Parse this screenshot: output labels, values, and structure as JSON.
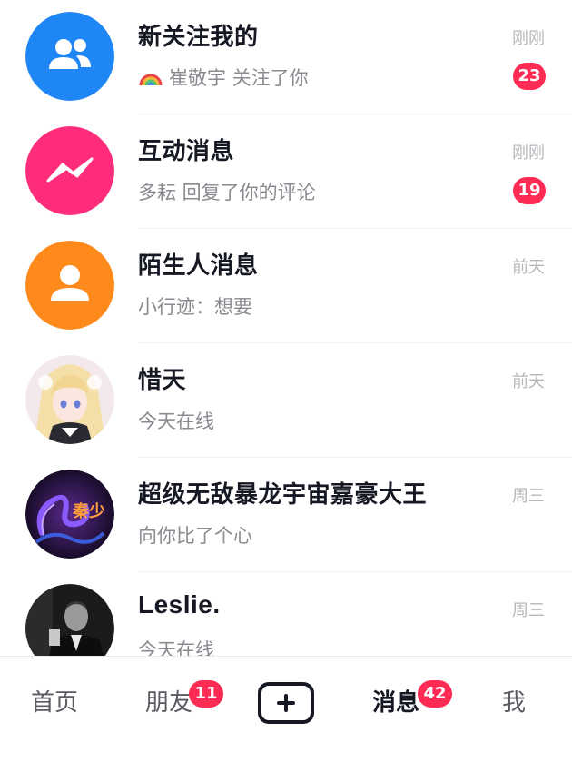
{
  "conversations": [
    {
      "title": "新关注我的",
      "subtitle": "崔敬宇 关注了你",
      "subtitle_icon": "rainbow-emoji",
      "time": "刚刚",
      "badge": "23",
      "avatar_icon": "users-icon",
      "avatar_color": "#1f86f6"
    },
    {
      "title": "互动消息",
      "subtitle": "多耘 回复了你的评论",
      "time": "刚刚",
      "badge": "19",
      "avatar_icon": "interaction-icon",
      "avatar_color": "#fe2c7a"
    },
    {
      "title": "陌生人消息",
      "subtitle": "小行迹：想要",
      "time": "前天",
      "avatar_icon": "person-icon",
      "avatar_color": "#ff8a1c"
    },
    {
      "title": "惜天",
      "subtitle": "今天在线",
      "time": "前天",
      "avatar_icon": "anime-avatar"
    },
    {
      "title": "超级无敌暴龙宇宙嘉豪大王",
      "subtitle": "向你比了个心",
      "time": "周三",
      "avatar_icon": "dragon-avatar",
      "avatar_text": "秦少"
    },
    {
      "title": "Leslie.",
      "subtitle": "今天在线",
      "time": "周三",
      "avatar_icon": "photo-avatar"
    }
  ],
  "tabbar": {
    "home": "首页",
    "friends": "朋友",
    "friends_badge": "11",
    "publish_icon": "plus-icon",
    "messages": "消息",
    "messages_badge": "42",
    "me": "我"
  },
  "colors": {
    "badge": "#fe2c55",
    "title": "#161823",
    "subtitle": "#8a8b91",
    "time": "#b6b7bb"
  }
}
